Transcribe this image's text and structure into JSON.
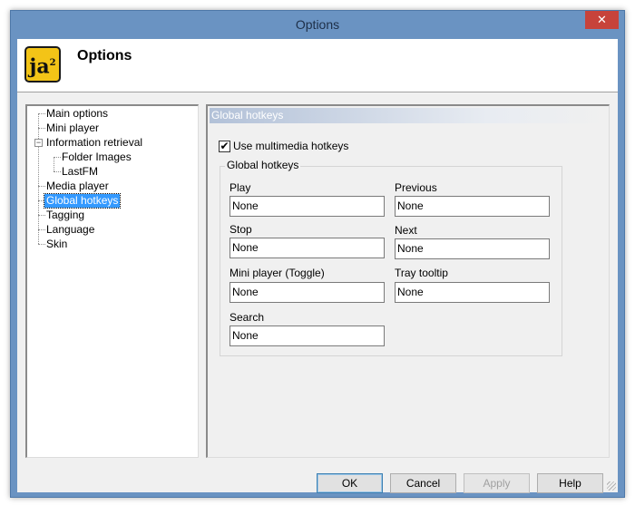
{
  "window": {
    "title": "Options",
    "close_glyph": "✕"
  },
  "header": {
    "logo_text": "ja",
    "logo_sup": "2",
    "title": "Options"
  },
  "tree": {
    "items": [
      {
        "label": "Main options",
        "level": 0,
        "selected": false
      },
      {
        "label": "Mini player",
        "level": 0,
        "selected": false
      },
      {
        "label": "Information retrieval",
        "level": 0,
        "selected": false,
        "expanded": true
      },
      {
        "label": "Folder Images",
        "level": 1,
        "selected": false
      },
      {
        "label": "LastFM",
        "level": 1,
        "selected": false
      },
      {
        "label": "Media player",
        "level": 0,
        "selected": false
      },
      {
        "label": "Global hotkeys",
        "level": 0,
        "selected": true
      },
      {
        "label": "Tagging",
        "level": 0,
        "selected": false
      },
      {
        "label": "Language",
        "level": 0,
        "selected": false
      },
      {
        "label": "Skin",
        "level": 0,
        "selected": false
      }
    ],
    "expander_glyph": "−"
  },
  "panel": {
    "header": "Global hotkeys",
    "use_multimedia": {
      "label": "Use multimedia hotkeys",
      "checked": true,
      "glyph": "✔"
    },
    "group_title": "Global hotkeys",
    "hotkeys": [
      {
        "label": "Play",
        "value": "None"
      },
      {
        "label": "Previous",
        "value": "None"
      },
      {
        "label": "Stop",
        "value": "None"
      },
      {
        "label": "Next",
        "value": "None"
      },
      {
        "label": "Mini player (Toggle)",
        "value": "None"
      },
      {
        "label": "Tray tooltip",
        "value": "None"
      },
      {
        "label": "Search",
        "value": "None"
      }
    ]
  },
  "buttons": {
    "ok": "OK",
    "cancel": "Cancel",
    "apply": "Apply",
    "help": "Help"
  }
}
